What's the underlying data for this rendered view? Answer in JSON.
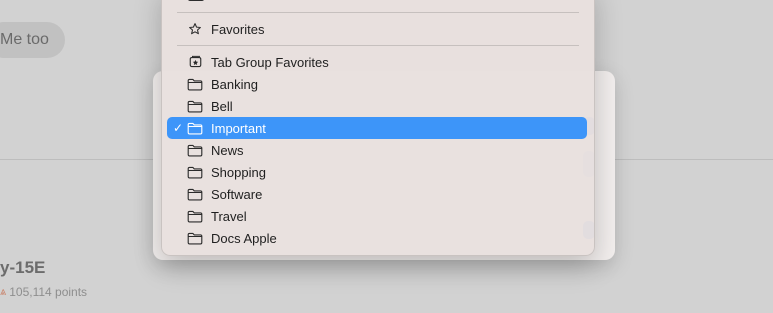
{
  "background": {
    "bubble_text": "Me too",
    "username": "y-15E",
    "points": "105,114 points"
  },
  "menu": {
    "favorites_label": "Favorites",
    "items": [
      {
        "label": "Tab Group Favorites",
        "icon": "tab-group-star-icon",
        "selected": false
      },
      {
        "label": "Banking",
        "icon": "folder-icon",
        "selected": false
      },
      {
        "label": "Bell",
        "icon": "folder-icon",
        "selected": false
      },
      {
        "label": "Important",
        "icon": "folder-icon",
        "selected": true
      },
      {
        "label": "News",
        "icon": "folder-icon",
        "selected": false
      },
      {
        "label": "Shopping",
        "icon": "folder-icon",
        "selected": false
      },
      {
        "label": "Software",
        "icon": "folder-icon",
        "selected": false
      },
      {
        "label": "Travel",
        "icon": "folder-icon",
        "selected": false
      },
      {
        "label": "Docs Apple",
        "icon": "folder-icon",
        "selected": false
      }
    ],
    "check_glyph": "✓"
  },
  "colors": {
    "selection": "#3d95f9",
    "accent_button": "#2f7df0"
  }
}
